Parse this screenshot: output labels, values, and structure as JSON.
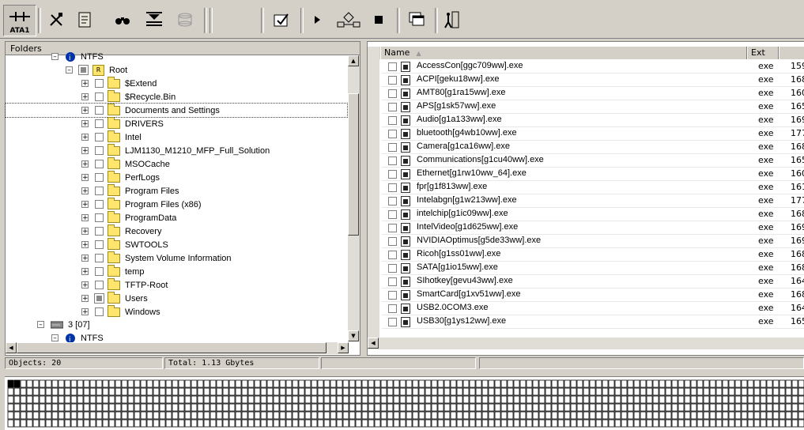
{
  "toolbar": {
    "ata_label": "ATA1"
  },
  "folders": {
    "header": "Folders",
    "root_partition": "NTFS",
    "root": "Root",
    "items": [
      {
        "label": "$Extend",
        "partial": false
      },
      {
        "label": "$Recycle.Bin",
        "partial": false
      },
      {
        "label": "Documents and Settings",
        "partial": false
      },
      {
        "label": "DRIVERS",
        "partial": false
      },
      {
        "label": "Intel",
        "partial": false
      },
      {
        "label": "LJM1130_M1210_MFP_Full_Solution",
        "partial": false
      },
      {
        "label": "MSOCache",
        "partial": false
      },
      {
        "label": "PerfLogs",
        "partial": false
      },
      {
        "label": "Program Files",
        "partial": false
      },
      {
        "label": "Program Files (x86)",
        "partial": false
      },
      {
        "label": "ProgramData",
        "partial": false
      },
      {
        "label": "Recovery",
        "partial": false
      },
      {
        "label": "SWTOOLS",
        "partial": false
      },
      {
        "label": "System Volume Information",
        "partial": false
      },
      {
        "label": "temp",
        "partial": false
      },
      {
        "label": "TFTP-Root",
        "partial": false
      },
      {
        "label": "Users",
        "partial": true
      },
      {
        "label": "Windows",
        "partial": false
      }
    ],
    "disk3": "3 [07]",
    "disk3_partition": "NTFS"
  },
  "files": {
    "col_name": "Name",
    "col_ext": "Ext",
    "rows": [
      {
        "name": "AccessCon[ggc709ww].exe",
        "ext": "exe",
        "size": "159"
      },
      {
        "name": "ACPI[geku18ww].exe",
        "ext": "exe",
        "size": "168"
      },
      {
        "name": "AMT80[g1ra15ww].exe",
        "ext": "exe",
        "size": "160"
      },
      {
        "name": "APS[g1sk57ww].exe",
        "ext": "exe",
        "size": "165"
      },
      {
        "name": "Audio[g1a133ww].exe",
        "ext": "exe",
        "size": "169"
      },
      {
        "name": "bluetooth[g4wb10ww].exe",
        "ext": "exe",
        "size": "177"
      },
      {
        "name": "Camera[g1ca16ww].exe",
        "ext": "exe",
        "size": "168"
      },
      {
        "name": "Communications[g1cu40ww].exe",
        "ext": "exe",
        "size": "165"
      },
      {
        "name": "Ethernet[g1rw10ww_64].exe",
        "ext": "exe",
        "size": "160"
      },
      {
        "name": "fpr[g1f813ww].exe",
        "ext": "exe",
        "size": "161"
      },
      {
        "name": "Intelabgn[g1w213ww].exe",
        "ext": "exe",
        "size": "177"
      },
      {
        "name": "intelchip[g1ic09ww].exe",
        "ext": "exe",
        "size": "168"
      },
      {
        "name": "IntelVideo[g1d625ww].exe",
        "ext": "exe",
        "size": "169"
      },
      {
        "name": "NVIDIAOptimus[g5de33ww].exe",
        "ext": "exe",
        "size": "169"
      },
      {
        "name": "Ricoh[g1ss01ww].exe",
        "ext": "exe",
        "size": "168"
      },
      {
        "name": "SATA[g1io15ww].exe",
        "ext": "exe",
        "size": "168"
      },
      {
        "name": "SIhotkey[gevu43ww].exe",
        "ext": "exe",
        "size": "164"
      },
      {
        "name": "SmartCard[g1xv51ww].exe",
        "ext": "exe",
        "size": "168"
      },
      {
        "name": "USB2.0COM3.exe",
        "ext": "exe",
        "size": "164"
      },
      {
        "name": "USB30[g1ys12ww].exe",
        "ext": "exe",
        "size": "165"
      }
    ]
  },
  "status": {
    "objects": "Objects: 20",
    "total": "Total: 1.13 Gbytes"
  }
}
